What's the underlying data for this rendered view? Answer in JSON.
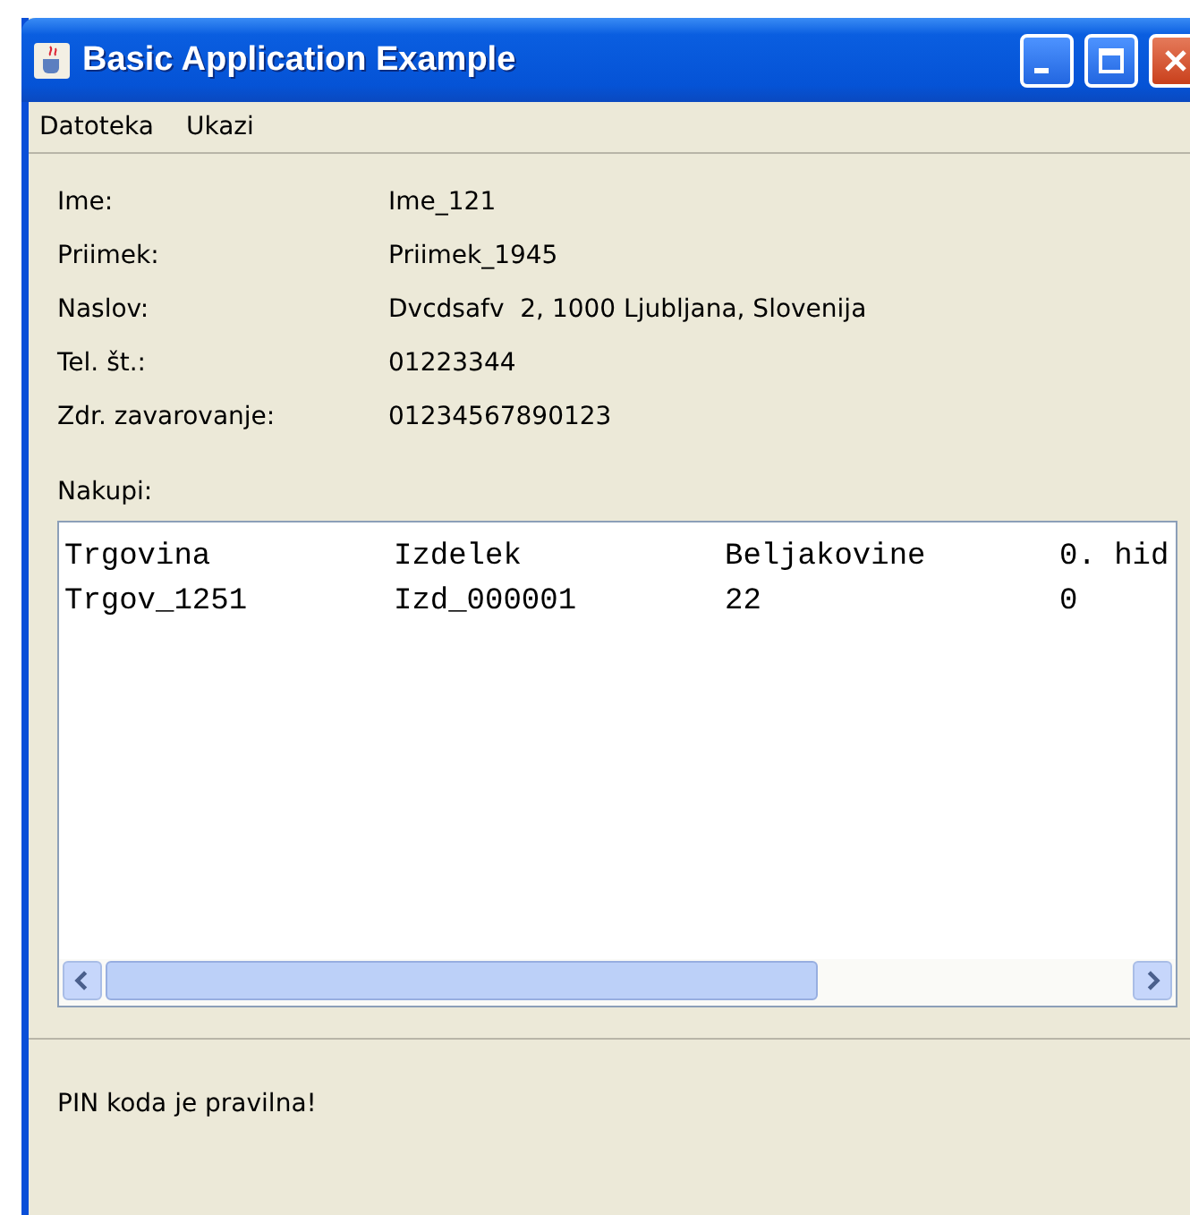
{
  "window": {
    "title": "Basic Application Example"
  },
  "menu": [
    "Datoteka",
    "Ukazi"
  ],
  "fields": [
    {
      "label": "Ime:",
      "value": "Ime_121"
    },
    {
      "label": "Priimek:",
      "value": "Priimek_1945"
    },
    {
      "label": "Naslov:",
      "value": "Dvcdsafv  2, 1000 Ljubljana, Slovenija"
    },
    {
      "label": "Tel. št.:",
      "value": "01223344"
    },
    {
      "label": "Zdr. zavarovanje:",
      "value": "01234567890123"
    }
  ],
  "purchases": {
    "label": "Nakupi:",
    "columns": [
      "Trgovina",
      "Izdelek",
      "Beljakovine",
      "0. hid"
    ],
    "rows": [
      [
        "Trgov_1251",
        "Izd_000001",
        "22",
        "0"
      ]
    ]
  },
  "status_bar": "PIN koda je pravilna!"
}
